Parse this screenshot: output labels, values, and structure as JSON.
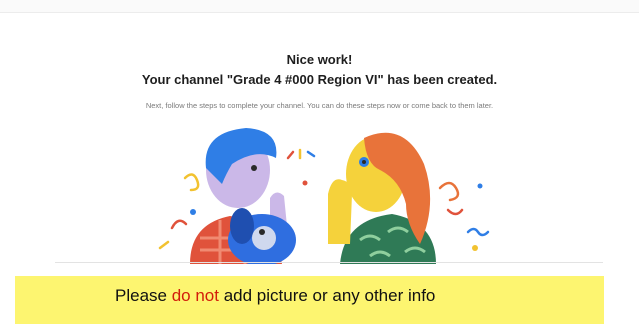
{
  "dialog": {
    "heading": "Nice work!",
    "title": "Your channel \"Grade 4 #000 Region VI\" has been created.",
    "subtitle": "Next, follow the steps to complete your channel. You can do these steps now or come back to them later."
  },
  "illustration": {
    "icon": "celebration-illustration",
    "colors": {
      "hair_left": "#2f7ee6",
      "hair_right": "#e8733a",
      "skin_left": "#cbb8e8",
      "skin_right": "#f5d23b",
      "shirt_left": "#e0523b",
      "shirt_right": "#2f7a56",
      "dog": "#2f6ee0"
    }
  },
  "note": {
    "prefix": "Please ",
    "emphasis": "do not",
    "suffix": " add picture or any other info",
    "highlight_color": "#fdf570",
    "emphasis_color": "#d21d0a"
  }
}
